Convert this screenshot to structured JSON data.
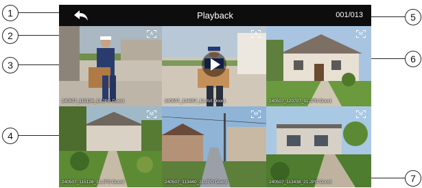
{
  "header": {
    "title": "Playback",
    "counter": "001/013"
  },
  "callouts": [
    "1",
    "2",
    "3",
    "4",
    "5",
    "6",
    "7"
  ],
  "tiles": [
    {
      "label": "240507_115126_13.JPG Door1",
      "badge": "A",
      "type": "photo"
    },
    {
      "label": "240507_134857_12.AVI Door1",
      "badge": "A",
      "type": "video"
    },
    {
      "label": "240507_120707_11.JPG Door1",
      "badge": "M",
      "type": "photo"
    },
    {
      "label": "240507_115126_21.JPG Door2",
      "badge": "M",
      "type": "photo"
    },
    {
      "label": "240507_113440_21.JPG Door2",
      "badge": "M",
      "type": "photo"
    },
    {
      "label": "240507_113438_21.JPG Door2",
      "badge": "M",
      "type": "photo"
    }
  ]
}
